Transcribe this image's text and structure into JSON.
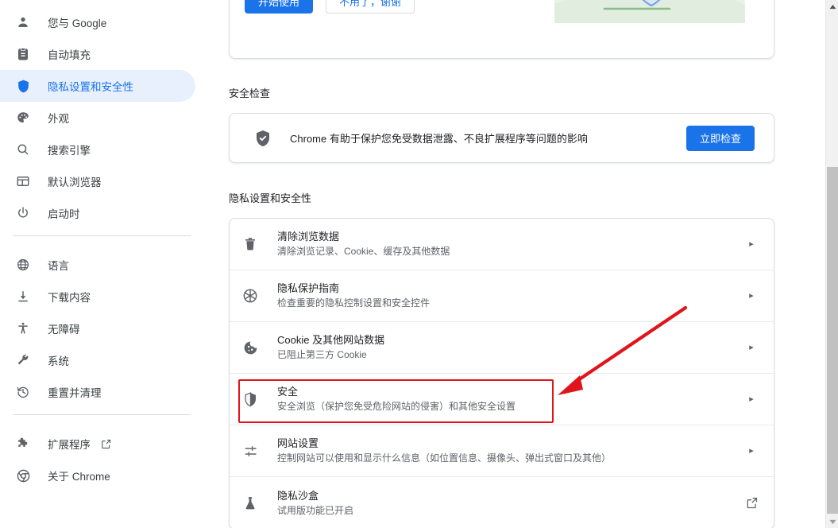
{
  "sidebar": {
    "groups": [
      {
        "items": [
          {
            "label": "您与 Google",
            "icon": "person-icon",
            "selected": false
          },
          {
            "label": "自动填充",
            "icon": "clipboard-icon",
            "selected": false
          },
          {
            "label": "隐私设置和安全性",
            "icon": "shield-icon",
            "selected": true
          },
          {
            "label": "外观",
            "icon": "palette-icon",
            "selected": false
          },
          {
            "label": "搜索引擎",
            "icon": "search-icon",
            "selected": false
          },
          {
            "label": "默认浏览器",
            "icon": "browser-window-icon",
            "selected": false
          },
          {
            "label": "启动时",
            "icon": "power-icon",
            "selected": false
          }
        ]
      },
      {
        "items": [
          {
            "label": "语言",
            "icon": "globe-icon",
            "selected": false
          },
          {
            "label": "下载内容",
            "icon": "download-icon",
            "selected": false
          },
          {
            "label": "无障碍",
            "icon": "accessibility-icon",
            "selected": false
          },
          {
            "label": "系统",
            "icon": "wrench-icon",
            "selected": false
          },
          {
            "label": "重置并清理",
            "icon": "history-restore-icon",
            "selected": false
          }
        ]
      },
      {
        "items": [
          {
            "label": "扩展程序",
            "icon": "puzzle-icon",
            "selected": false,
            "external": true
          },
          {
            "label": "关于 Chrome",
            "icon": "chrome-icon",
            "selected": false
          }
        ]
      }
    ]
  },
  "promo": {
    "primary_button": "开始使用",
    "secondary_button": "不用了，谢谢",
    "art": "shield-envelope-illustration"
  },
  "safety_check": {
    "section_title": "安全检查",
    "icon": "shield-check-icon",
    "description": "Chrome 有助于保护您免受数据泄露、不良扩展程序等问题的影响",
    "button": "立即检查"
  },
  "privacy": {
    "section_title": "隐私设置和安全性",
    "rows": [
      {
        "icon": "trash-icon",
        "title": "清除浏览数据",
        "subtitle": "清除浏览记录、Cookie、缓存及其他数据",
        "end": "caret",
        "highlighted": false
      },
      {
        "icon": "privacy-guide-icon",
        "title": "隐私保护指南",
        "subtitle": "检查重要的隐私控制设置和安全控件",
        "end": "caret",
        "highlighted": false
      },
      {
        "icon": "cookie-icon",
        "title": "Cookie 及其他网站数据",
        "subtitle": "已阻止第三方 Cookie",
        "end": "caret",
        "highlighted": false
      },
      {
        "icon": "shield-icon",
        "title": "安全",
        "subtitle": "安全浏览（保护您免受危险网站的侵害）和其他安全设置",
        "end": "caret",
        "highlighted": true
      },
      {
        "icon": "tune-sliders-icon",
        "title": "网站设置",
        "subtitle": "控制网站可以使用和显示什么信息（如位置信息、摄像头、弹出式窗口及其他）",
        "end": "caret",
        "highlighted": false
      },
      {
        "icon": "flask-icon",
        "title": "隐私沙盒",
        "subtitle": "试用版功能已开启",
        "end": "external-link",
        "highlighted": false
      }
    ]
  },
  "annotation": {
    "color": "#e0151b",
    "box_target": "安全",
    "arrow": "red-arrow-pointing-to-security-row"
  },
  "scrollbar": {
    "up_arrow": "scroll-up-icon",
    "down_arrow": "scroll-down-icon",
    "thumb": "scroll-thumb"
  },
  "colors": {
    "accent": "#1a73e8",
    "selected_bg": "#e8f0fe",
    "text_primary": "#202124",
    "text_secondary": "#5f6368",
    "annotation_red": "#e0151b"
  }
}
